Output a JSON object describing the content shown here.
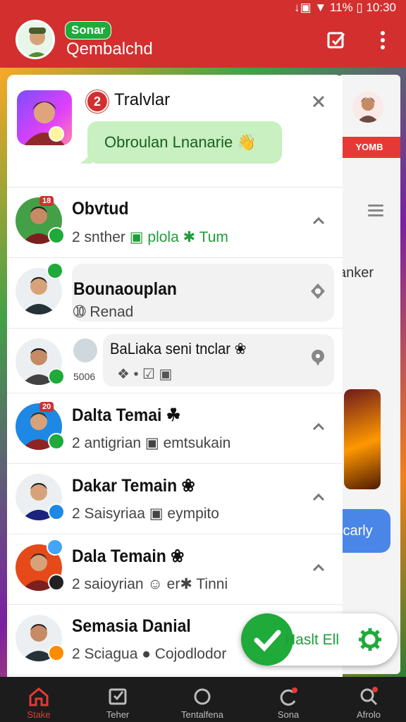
{
  "status_bar": {
    "text": "↓▣ ▼ 11% ▯ 10:30"
  },
  "header": {
    "badge": "Sonar",
    "subtitle": "Qembalchd"
  },
  "notification": {
    "badge_count": "2",
    "title": "Tralvlar",
    "message": "Obroulan Lnanarie 👋"
  },
  "background": {
    "tag": "YOMB",
    "partial_text": "anker",
    "button_text": "icarly"
  },
  "chats": [
    {
      "name": "Obvtud",
      "count": "18",
      "meta": "2 snther",
      "meta_green": "▣ plola ✱ Tum"
    },
    {
      "name": "Bounaouplan",
      "meta": "➉ Renad"
    },
    {
      "name": "BaLiaka seni tnclar ❀",
      "meta": "5006",
      "meta_icons": "❖ • ☑ ▣"
    },
    {
      "name": "Dalta Temai ☘",
      "count": "20",
      "meta": "2 antigrian ▣ emtsukain"
    },
    {
      "name": "Dakar Temain ❀",
      "meta": "2 Saisyriaa ▣ eympito"
    },
    {
      "name": "Dala Temain ❀",
      "meta": "2 saioyrian ☺ er✱ Tinni"
    },
    {
      "name": "Semasia Danial",
      "meta": "2 Sciagua ● Cojodlodor"
    }
  ],
  "fab": {
    "label": "Haslt Ell"
  },
  "tabs": [
    "Stake",
    "Teher",
    "Tentalfena",
    "Sona",
    "Afrolo"
  ],
  "colors": {
    "brand_red": "#d32f2f",
    "green": "#1faa3a"
  }
}
